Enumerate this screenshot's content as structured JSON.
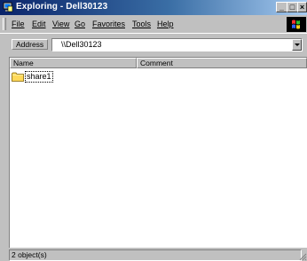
{
  "window": {
    "title": "Exploring - Dell30123",
    "minimize_glyph": "_",
    "maximize_glyph": "□",
    "close_glyph": "×"
  },
  "menu": {
    "items": [
      {
        "label": "File"
      },
      {
        "label": "Edit"
      },
      {
        "label": "View"
      },
      {
        "label": "Go"
      },
      {
        "label": "Favorites"
      },
      {
        "label": "Tools"
      },
      {
        "label": "Help"
      }
    ]
  },
  "address": {
    "label": "Address",
    "value": "\\\\Dell30123"
  },
  "list": {
    "columns": [
      {
        "label": "Name"
      },
      {
        "label": "Comment"
      }
    ],
    "rows": [
      {
        "name": "share1",
        "comment": ""
      }
    ]
  },
  "status": {
    "text": "2 object(s)"
  },
  "colors": {
    "title_bar_start": "#0a246a",
    "title_bar_end": "#a6caf0",
    "window_face": "#c0c0c0",
    "list_background": "#ffffff",
    "folder_yellow": "#ffd95a"
  },
  "icons": {
    "title": "network-computer-icon",
    "throbber": "windows-logo-icon",
    "folder": "folder-icon",
    "resize": "resize-grip-icon"
  }
}
